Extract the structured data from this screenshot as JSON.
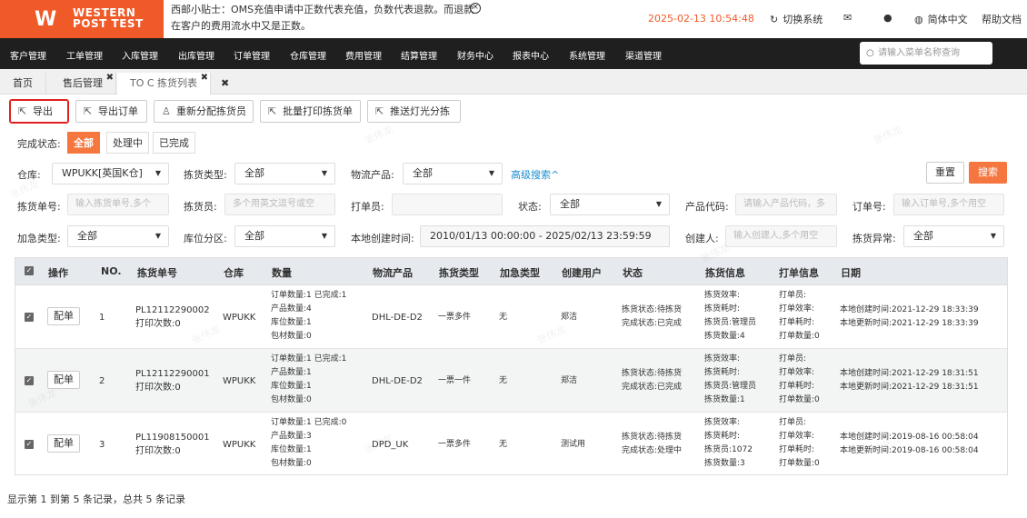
{
  "brand": {
    "logo_line1": "WESTERN",
    "logo_line2": "POST TEST"
  },
  "tip": {
    "line1": "西邮小贴士：OMS充值申请中正数代表充值，负数代表退款。而退款",
    "line2": "在客户的费用流水中又是正数。"
  },
  "topbar": {
    "datetime": "2025-02-13 10:54:48",
    "switch_system": "切换系统",
    "language": "简体中文",
    "help": "帮助文档"
  },
  "nav": [
    "客户管理",
    "工单管理",
    "入库管理",
    "出库管理",
    "订单管理",
    "仓库管理",
    "费用管理",
    "结算管理",
    "财务中心",
    "报表中心",
    "系统管理",
    "渠道管理"
  ],
  "menu_search": {
    "placeholder": "请输入菜单名称查询"
  },
  "tabs": [
    {
      "label": "首页"
    },
    {
      "label": "售后管理"
    },
    {
      "label": "TO C 拣货列表"
    }
  ],
  "toolbar": {
    "export": "导出",
    "export_order": "导出订单",
    "reassign": "重新分配拣货员",
    "batch_print": "批量打印拣货单",
    "push_light": "推送灯光分拣"
  },
  "filters": {
    "completion_label": "完成状态:",
    "completion_options": [
      "全部",
      "处理中",
      "已完成"
    ],
    "warehouse_label": "仓库:",
    "warehouse_value": "WPUKK[英国K仓]",
    "pick_type_label": "拣货类型:",
    "pick_type_value": "全部",
    "logistics_label": "物流产品:",
    "logistics_value": "全部",
    "advanced_search": "高级搜索^",
    "reset": "重置",
    "search": "搜索",
    "pick_no_label": "拣货单号:",
    "pick_no_placeholder": "输入拣货单号,多个",
    "picker_label": "拣货员:",
    "picker_placeholder": "多个用英文逗号或空",
    "printer_label": "打单员:",
    "status_label": "状态:",
    "status_value": "全部",
    "product_code_label": "产品代码:",
    "product_code_placeholder": "请输入产品代码，多",
    "order_no_label": "订单号:",
    "order_no_placeholder": "输入订单号,多个用空",
    "urgent_label": "加急类型:",
    "urgent_value": "全部",
    "zone_label": "库位分区:",
    "zone_value": "全部",
    "local_time_label": "本地创建时间:",
    "local_time_value": "2010/01/13 00:00:00 - 2025/02/13 23:59:59",
    "creator_label": "创建人:",
    "creator_placeholder": "输入创建人,多个用空",
    "exception_label": "拣货异常:",
    "exception_value": "全部"
  },
  "table": {
    "headers": [
      "操作",
      "NO.",
      "拣货单号",
      "仓库",
      "数量",
      "物流产品",
      "拣货类型",
      "加急类型",
      "创建用户",
      "状态",
      "拣货信息",
      "打单信息",
      "日期"
    ],
    "action_label": "配单",
    "rows": [
      {
        "no": "1",
        "pick_no": "PL12112290002",
        "print_count": "打印次数:0",
        "warehouse": "WPUKK",
        "qty": [
          "订单数量:1 已完成:1",
          "产品数量:4",
          "库位数量:1",
          "包材数量:0"
        ],
        "logistics": "DHL-DE-D2",
        "pick_type": "一票多件",
        "urgent": "无",
        "creator": "郑洁",
        "status": [
          "拣货状态:待拣货",
          "完成状态:已完成"
        ],
        "pick_info": [
          "拣货效率:",
          "拣货耗时:",
          "拣货员:管理员",
          "拣货数量:4"
        ],
        "print_info": [
          "打单员:",
          "打单效率:",
          "打单耗时:",
          "打单数量:0"
        ],
        "date": [
          "本地创建时间:2021-12-29 18:33:39",
          "本地更新时间:2021-12-29 18:33:39"
        ]
      },
      {
        "no": "2",
        "pick_no": "PL12112290001",
        "print_count": "打印次数:0",
        "warehouse": "WPUKK",
        "qty": [
          "订单数量:1 已完成:1",
          "产品数量:1",
          "库位数量:1",
          "包材数量:0"
        ],
        "logistics": "DHL-DE-D2",
        "pick_type": "一票一件",
        "urgent": "无",
        "creator": "郑洁",
        "status": [
          "拣货状态:待拣货",
          "完成状态:已完成"
        ],
        "pick_info": [
          "拣货效率:",
          "拣货耗时:",
          "拣货员:管理员",
          "拣货数量:1"
        ],
        "print_info": [
          "打单员:",
          "打单效率:",
          "打单耗时:",
          "打单数量:0"
        ],
        "date": [
          "本地创建时间:2021-12-29 18:31:51",
          "本地更新时间:2021-12-29 18:31:51"
        ]
      },
      {
        "no": "3",
        "pick_no": "PL11908150001",
        "print_count": "打印次数:0",
        "warehouse": "WPUKK",
        "qty": [
          "订单数量:1 已完成:0",
          "产品数量:3",
          "库位数量:1",
          "包材数量:0"
        ],
        "logistics": "DPD_UK",
        "pick_type": "一票多件",
        "urgent": "无",
        "creator": "测试用",
        "status": [
          "拣货状态:待拣货",
          "完成状态:处理中"
        ],
        "pick_info": [
          "拣货效率:",
          "拣货耗时:",
          "拣货员:1072",
          "拣货数量:3"
        ],
        "print_info": [
          "打单员:",
          "打单效率:",
          "打单耗时:",
          "打单数量:0"
        ],
        "date": [
          "本地创建时间:2019-08-16 00:58:04",
          "本地更新时间:2019-08-16 00:58:04"
        ]
      }
    ]
  },
  "footer": {
    "summary": "显示第 1 到第 5 条记录，总共 5 条记录"
  },
  "watermark": "张伟龙",
  "colors": {
    "accent": "#f5773f",
    "nav_bg": "#1f1f1f",
    "datetime": "#f05a28",
    "link": "#1a8fd1"
  }
}
